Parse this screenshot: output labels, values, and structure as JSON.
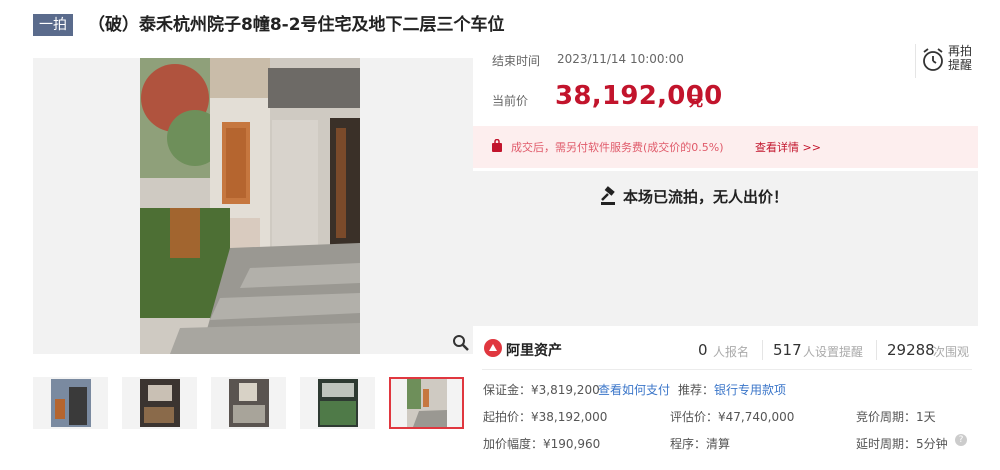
{
  "header": {
    "tag": "一拍",
    "title": "（破）泰禾杭州院子8幢8-2号住宅及地下二层三个车位"
  },
  "auction": {
    "end_label": "结束时间",
    "end_time": "2023/11/14 10:00:00",
    "remind_label": "再拍提醒",
    "price_label": "当前价",
    "price": "38,192,000",
    "price_unit": "元",
    "notice_text": "成交后，需另付软件服务费(成交价的0.5%)",
    "notice_link": "查看详情 >>",
    "status": "本场已流拍，无人出价！"
  },
  "platform": {
    "name": "阿里资产",
    "signups": "0",
    "signups_label": "人报名",
    "reminders": "517",
    "reminders_label": "人设置提醒",
    "views": "29288",
    "views_label": "次围观"
  },
  "details": {
    "deposit": "保证金：¥3,819,200",
    "deposit_link": "查看如何支付",
    "recommend_label": "推荐：",
    "recommend_link": "银行专用款项",
    "start_price": "起拍价：¥38,192,000",
    "appraisal": "评估价：¥47,740,000",
    "bid_period": "竞价周期：1天",
    "increment": "加价幅度：¥190,960",
    "procedure": "程序：清算",
    "delay": "延时周期：5分钟",
    "help": "?"
  },
  "colors": {
    "price": "#c2142c",
    "tag_bg": "#5a6b8c",
    "link": "#3b76c9"
  }
}
